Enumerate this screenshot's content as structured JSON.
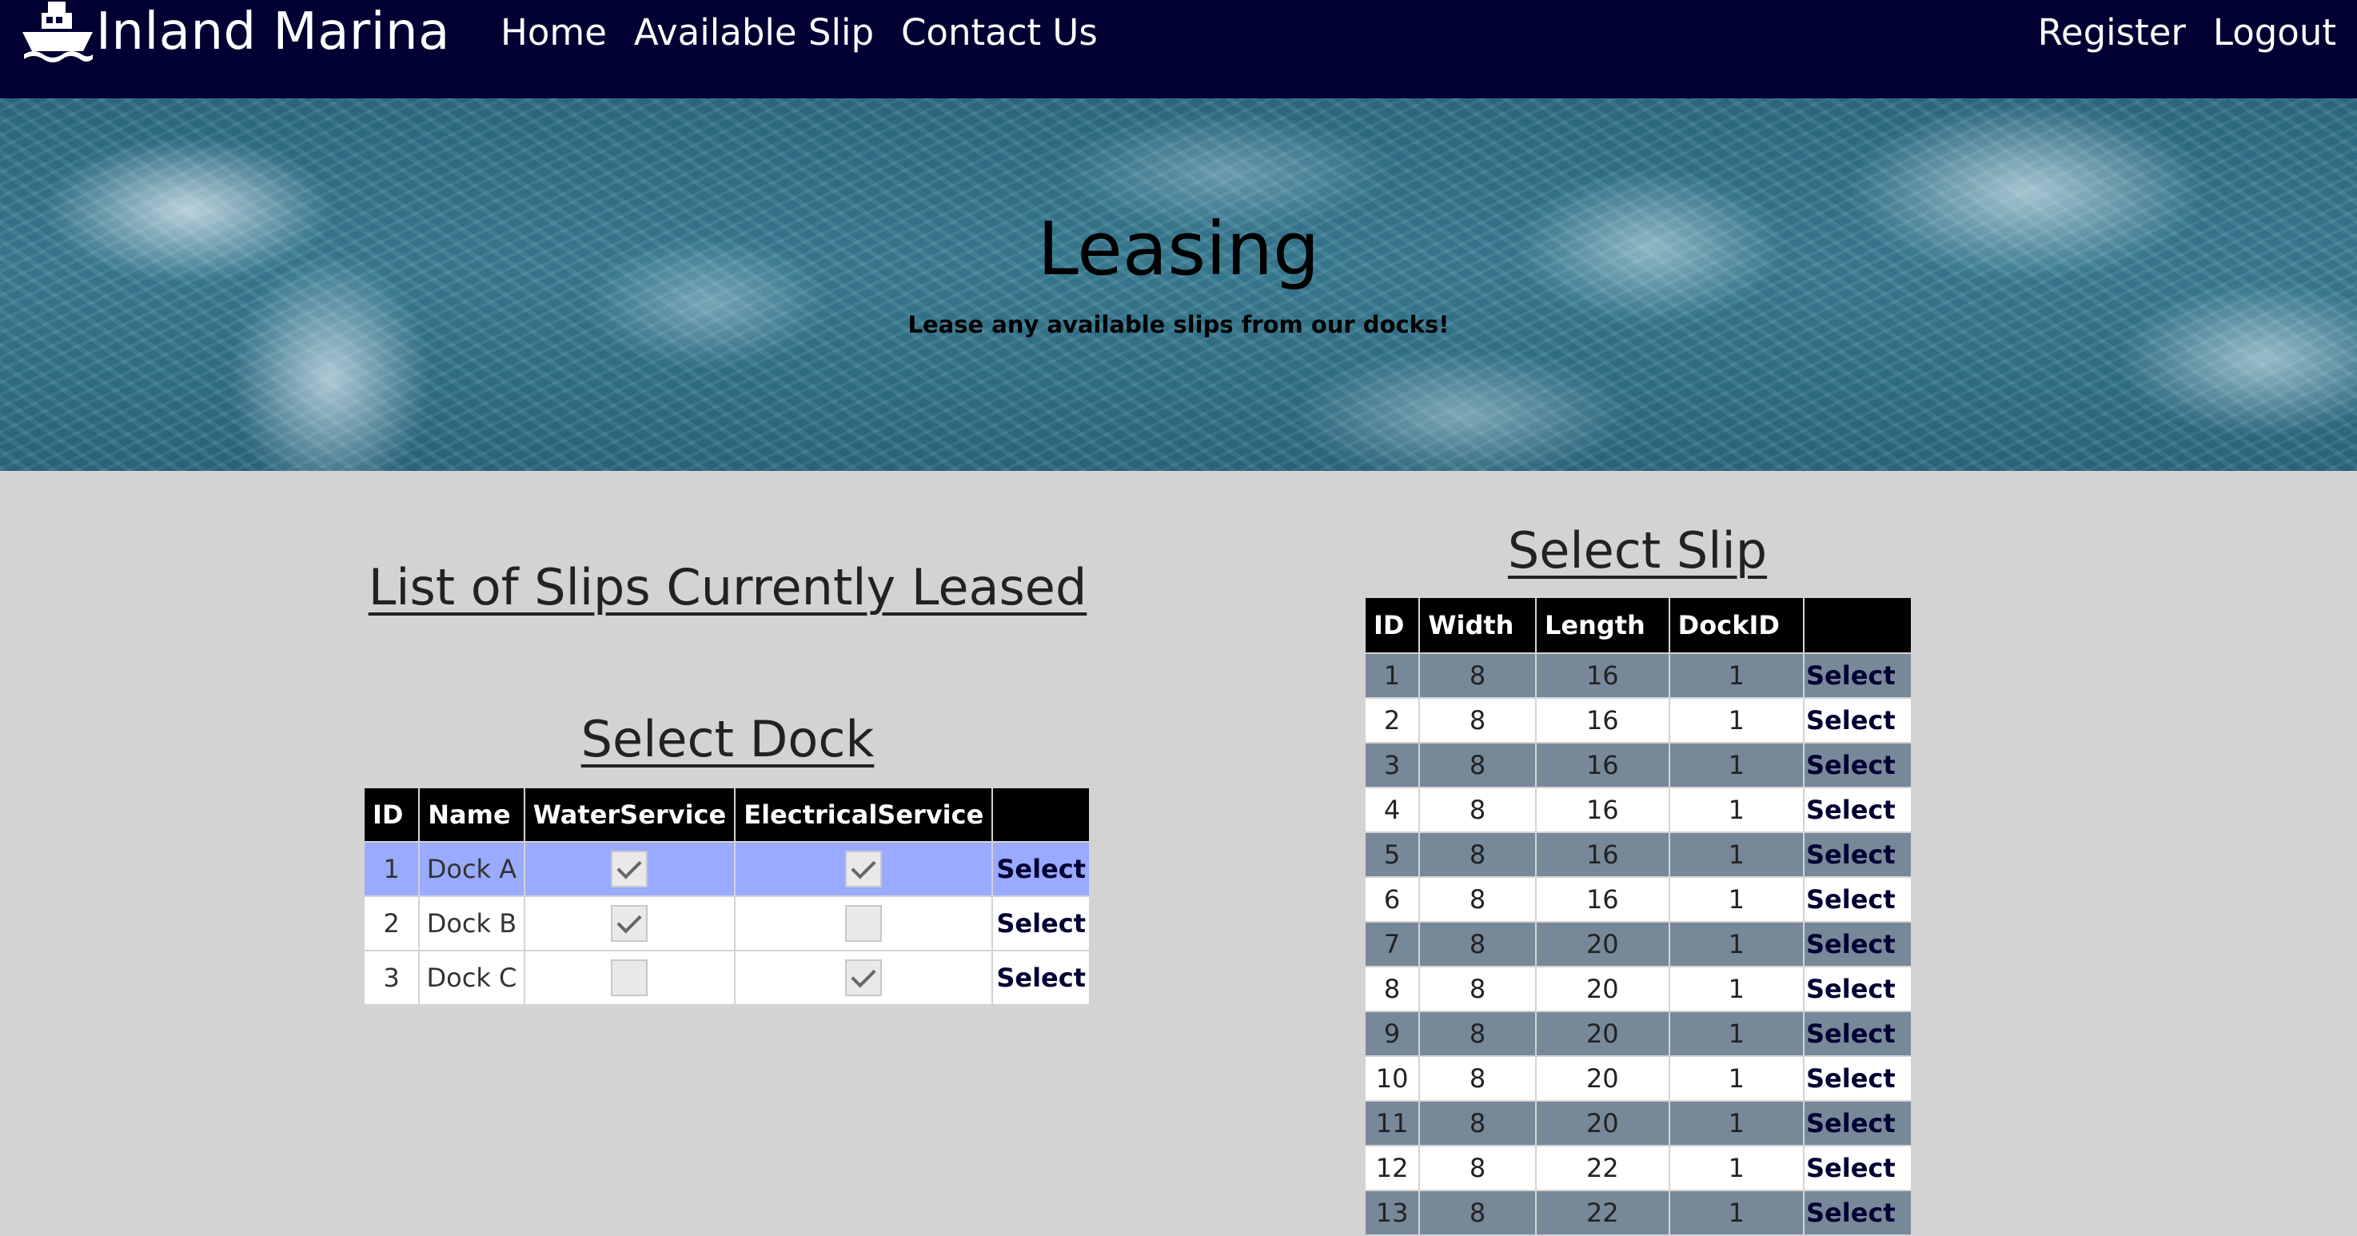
{
  "nav": {
    "brand": "Inland Marina",
    "links": [
      "Home",
      "Available Slip",
      "Contact Us"
    ],
    "right_links": [
      "Register",
      "Logout"
    ]
  },
  "hero": {
    "title": "Leasing",
    "subtitle": "Lease any available slips from our docks!"
  },
  "leased": {
    "heading": "List of Slips Currently Leased"
  },
  "dock": {
    "heading": "Select Dock",
    "columns": [
      "ID",
      "Name",
      "WaterService",
      "ElectricalService",
      ""
    ],
    "rows": [
      {
        "id": "1",
        "name": "Dock A",
        "water": true,
        "electrical": true,
        "action": "Select",
        "selected": true
      },
      {
        "id": "2",
        "name": "Dock B",
        "water": true,
        "electrical": false,
        "action": "Select",
        "selected": false
      },
      {
        "id": "3",
        "name": "Dock C",
        "water": false,
        "electrical": true,
        "action": "Select",
        "selected": false
      }
    ]
  },
  "slip": {
    "heading": "Select Slip",
    "columns": [
      "ID",
      "Width",
      "Length",
      "DockID",
      ""
    ],
    "rows": [
      {
        "id": "1",
        "width": "8",
        "length": "16",
        "dock_id": "1",
        "action": "Select"
      },
      {
        "id": "2",
        "width": "8",
        "length": "16",
        "dock_id": "1",
        "action": "Select"
      },
      {
        "id": "3",
        "width": "8",
        "length": "16",
        "dock_id": "1",
        "action": "Select"
      },
      {
        "id": "4",
        "width": "8",
        "length": "16",
        "dock_id": "1",
        "action": "Select"
      },
      {
        "id": "5",
        "width": "8",
        "length": "16",
        "dock_id": "1",
        "action": "Select"
      },
      {
        "id": "6",
        "width": "8",
        "length": "16",
        "dock_id": "1",
        "action": "Select"
      },
      {
        "id": "7",
        "width": "8",
        "length": "20",
        "dock_id": "1",
        "action": "Select"
      },
      {
        "id": "8",
        "width": "8",
        "length": "20",
        "dock_id": "1",
        "action": "Select"
      },
      {
        "id": "9",
        "width": "8",
        "length": "20",
        "dock_id": "1",
        "action": "Select"
      },
      {
        "id": "10",
        "width": "8",
        "length": "20",
        "dock_id": "1",
        "action": "Select"
      },
      {
        "id": "11",
        "width": "8",
        "length": "20",
        "dock_id": "1",
        "action": "Select"
      },
      {
        "id": "12",
        "width": "8",
        "length": "22",
        "dock_id": "1",
        "action": "Select"
      },
      {
        "id": "13",
        "width": "8",
        "length": "22",
        "dock_id": "1",
        "action": "Select"
      }
    ]
  },
  "colors": {
    "navbar": "#000033",
    "page_background": "#d3d3d3",
    "selected_row": "#99aaff",
    "striped_row": "#778899",
    "link": "#000033"
  }
}
